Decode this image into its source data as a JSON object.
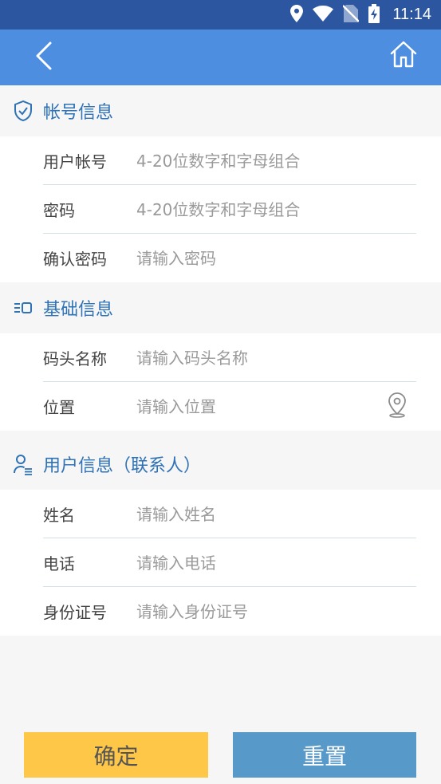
{
  "status_bar": {
    "time": "11:14",
    "icons": [
      "location-icon",
      "wifi-icon",
      "no-sim-icon",
      "battery-charging-icon"
    ]
  },
  "toolbar": {
    "back_icon": "chevron-left-icon",
    "home_icon": "home-icon"
  },
  "sections": {
    "account": {
      "title": "帐号信息",
      "icon": "shield-check-icon",
      "fields": {
        "username": {
          "label": "用户帐号",
          "placeholder": "4-20位数字和字母组合"
        },
        "password": {
          "label": "密码",
          "placeholder": "4-20位数字和字母组合"
        },
        "confirm_password": {
          "label": "确认密码",
          "placeholder": "请输入密码"
        }
      }
    },
    "basic": {
      "title": "基础信息",
      "icon": "list-icon",
      "fields": {
        "dock_name": {
          "label": "码头名称",
          "placeholder": "请输入码头名称"
        },
        "location": {
          "label": "位置",
          "placeholder": "请输入位置",
          "icon": "map-pin-icon"
        }
      }
    },
    "user": {
      "title": "用户信息（联系人）",
      "icon": "user-list-icon",
      "fields": {
        "name": {
          "label": "姓名",
          "placeholder": "请输入姓名"
        },
        "phone": {
          "label": "电话",
          "placeholder": "请输入电话"
        },
        "id_number": {
          "label": "身份证号",
          "placeholder": "请输入身份证号"
        }
      }
    }
  },
  "buttons": {
    "confirm": "确定",
    "reset": "重置"
  },
  "colors": {
    "status_bar": "#2c56a0",
    "toolbar": "#4d8ee0",
    "section_title": "#2f72b5",
    "confirm_button": "#ffc748",
    "reset_button": "#5799c8"
  }
}
